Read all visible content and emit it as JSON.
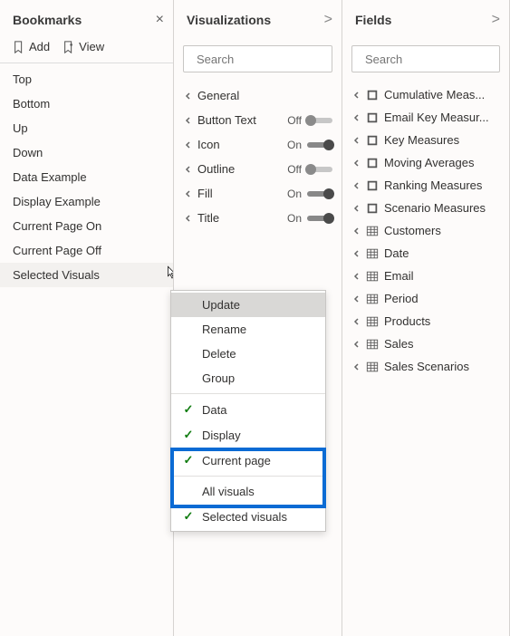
{
  "bookmarks": {
    "title": "Bookmarks",
    "close_glyph": "×",
    "add_label": "Add",
    "view_label": "View",
    "items": [
      {
        "label": "Top"
      },
      {
        "label": "Bottom"
      },
      {
        "label": "Up"
      },
      {
        "label": "Down"
      },
      {
        "label": "Data Example"
      },
      {
        "label": "Display Example"
      },
      {
        "label": "Current Page On"
      },
      {
        "label": "Current Page Off"
      },
      {
        "label": "Selected Visuals",
        "selected": true
      }
    ]
  },
  "viz": {
    "title": "Visualizations",
    "collapse_glyph": ">",
    "search_placeholder": "Search",
    "props": [
      {
        "label": "General",
        "toggle": null
      },
      {
        "label": "Button Text",
        "toggle": "Off"
      },
      {
        "label": "Icon",
        "toggle": "On"
      },
      {
        "label": "Outline",
        "toggle": "Off"
      },
      {
        "label": "Fill",
        "toggle": "On"
      },
      {
        "label": "Title",
        "toggle": "On"
      }
    ]
  },
  "fields": {
    "title": "Fields",
    "collapse_glyph": ">",
    "search_placeholder": "Search",
    "items": [
      {
        "label": "Cumulative Meas...",
        "icon": "measure"
      },
      {
        "label": "Email Key Measur...",
        "icon": "measure"
      },
      {
        "label": "Key Measures",
        "icon": "measure"
      },
      {
        "label": "Moving Averages",
        "icon": "measure"
      },
      {
        "label": "Ranking Measures",
        "icon": "measure"
      },
      {
        "label": "Scenario Measures",
        "icon": "measure"
      },
      {
        "label": "Customers",
        "icon": "table"
      },
      {
        "label": "Date",
        "icon": "table"
      },
      {
        "label": "Email",
        "icon": "table"
      },
      {
        "label": "Period",
        "icon": "table"
      },
      {
        "label": "Products",
        "icon": "table"
      },
      {
        "label": "Sales",
        "icon": "table"
      },
      {
        "label": "Sales Scenarios",
        "icon": "table"
      }
    ]
  },
  "context_menu": {
    "items": [
      {
        "label": "Update",
        "highlight": true,
        "checked": false,
        "sep_before": false
      },
      {
        "label": "Rename",
        "highlight": false,
        "checked": false,
        "sep_before": false
      },
      {
        "label": "Delete",
        "highlight": false,
        "checked": false,
        "sep_before": false
      },
      {
        "label": "Group",
        "highlight": false,
        "checked": false,
        "sep_before": false
      },
      {
        "label": "Data",
        "highlight": false,
        "checked": true,
        "sep_before": true
      },
      {
        "label": "Display",
        "highlight": false,
        "checked": true,
        "sep_before": false
      },
      {
        "label": "Current page",
        "highlight": false,
        "checked": true,
        "sep_before": false
      },
      {
        "label": "All visuals",
        "highlight": false,
        "checked": false,
        "sep_before": true
      },
      {
        "label": "Selected visuals",
        "highlight": false,
        "checked": true,
        "sep_before": false
      }
    ]
  }
}
